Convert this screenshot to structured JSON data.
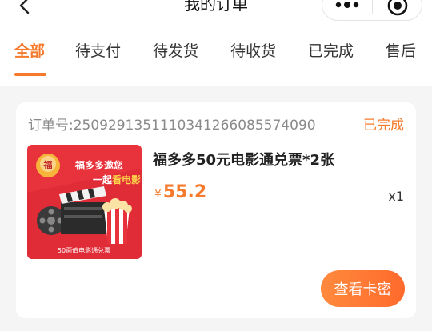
{
  "header": {
    "title": "我的订单"
  },
  "tabs": [
    {
      "label": "全部",
      "active": true
    },
    {
      "label": "待支付",
      "active": false
    },
    {
      "label": "待发货",
      "active": false
    },
    {
      "label": "待收货",
      "active": false
    },
    {
      "label": "已完成",
      "active": false
    },
    {
      "label": "售后",
      "active": false
    }
  ],
  "order": {
    "order_no": "订单号:2509291351110341266085574090",
    "status": "已完成",
    "product_name": "福多多50元电影通兑票*2张",
    "currency": "¥",
    "price": "55.2",
    "quantity": "x1",
    "action_label": "查看卡密",
    "thumbnail": {
      "line1": "福多多邀您",
      "line2_prefix": "一起",
      "line2_highlight": "看电影",
      "footer": "50面值电影通兑票",
      "badge": "福",
      "background": "#e8323c"
    }
  },
  "colors": {
    "accent": "#f57a2c",
    "background": "#f5f5f5"
  }
}
